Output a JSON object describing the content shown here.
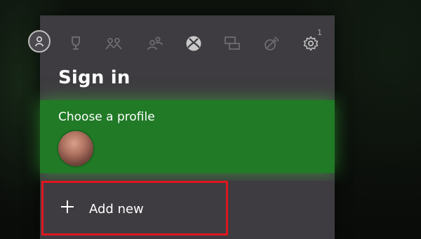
{
  "header": {
    "tabs": [
      {
        "icon": "trophy-icon"
      },
      {
        "icon": "friends-icon"
      },
      {
        "icon": "party-icon"
      },
      {
        "icon": "xbox-icon"
      },
      {
        "icon": "messages-icon"
      },
      {
        "icon": "broadcast-icon"
      },
      {
        "icon": "settings-icon",
        "badge": "1"
      }
    ]
  },
  "panel": {
    "title": "Sign in",
    "profile_prompt": "Choose a profile",
    "add_new_label": "Add new"
  },
  "colors": {
    "guide_bg": "#3e3c40",
    "accent_green": "#217a26",
    "highlight_red": "#e0161f"
  }
}
